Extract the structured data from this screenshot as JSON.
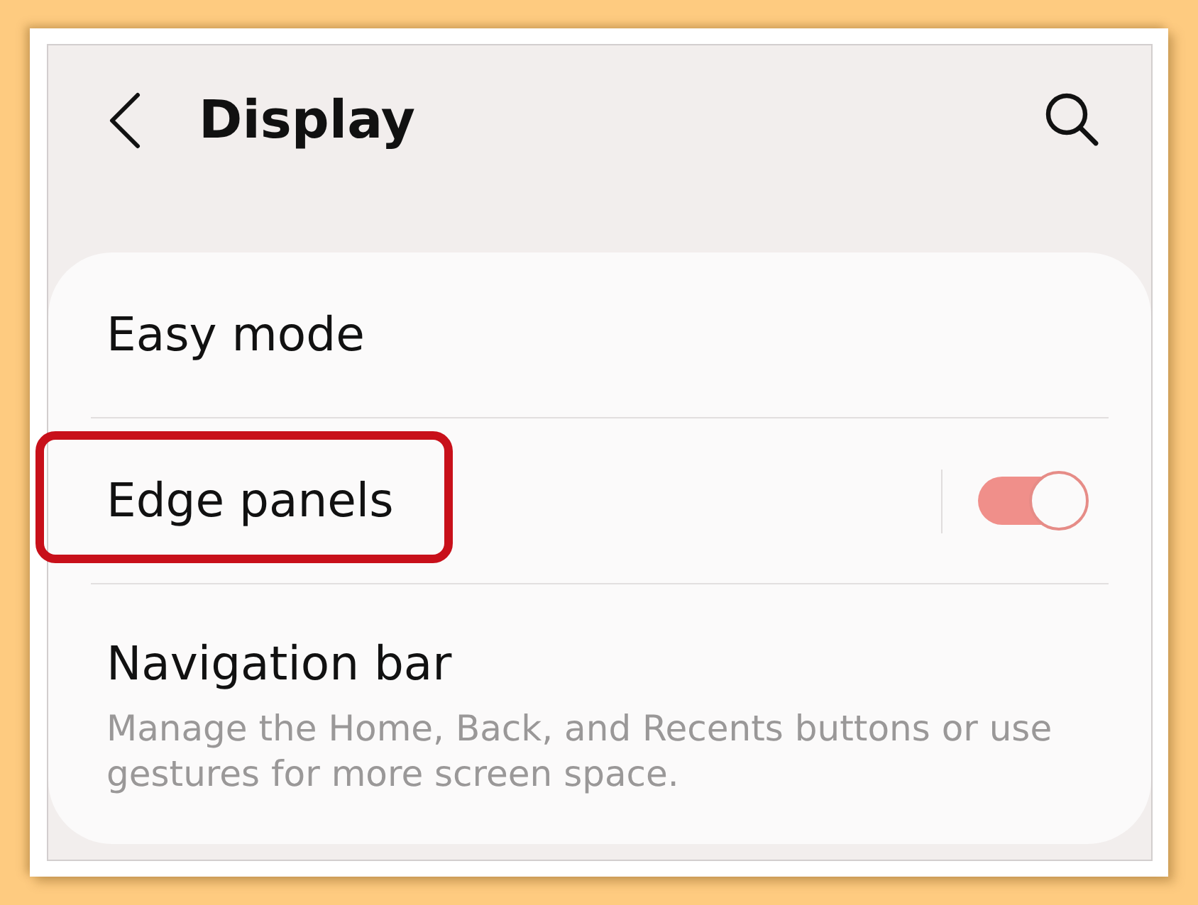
{
  "header": {
    "title": "Display"
  },
  "settings": [
    {
      "kind": "plain",
      "title": "Easy mode",
      "highlighted": false
    },
    {
      "kind": "toggle",
      "title": "Edge panels",
      "on": true,
      "highlighted": true
    },
    {
      "kind": "plain",
      "title": "Navigation bar",
      "description": "Manage the Home, Back, and Recents buttons or use gestures for more screen space.",
      "highlighted": false
    }
  ]
}
